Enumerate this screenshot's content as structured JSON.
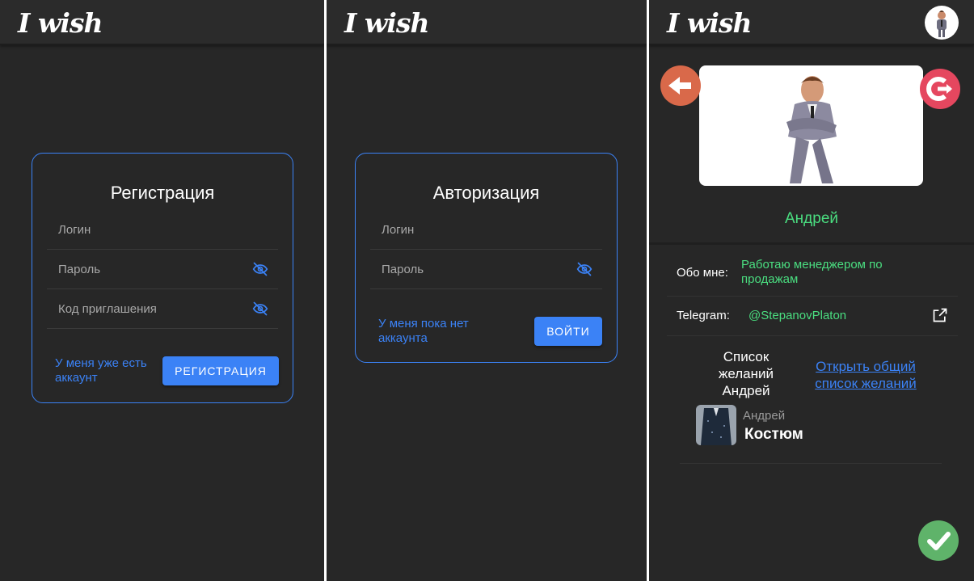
{
  "app": {
    "logo": "I wish"
  },
  "register": {
    "title": "Регистрация",
    "login_label": "Логин",
    "password_label": "Пароль",
    "invite_label": "Код приглашения",
    "have_account_link": "У меня уже есть аккаунт",
    "submit_label": "РЕГИСТРАЦИЯ"
  },
  "auth": {
    "title": "Авторизация",
    "login_label": "Логин",
    "password_label": "Пароль",
    "no_account_link": "У меня пока нет аккаунта",
    "submit_label": "ВОЙТИ"
  },
  "profile": {
    "name": "Андрей",
    "about_label": "Обо мне:",
    "about_value": "Работаю менеджером по продажам",
    "telegram_label": "Telegram:",
    "telegram_value": "@StepanovPlaton",
    "wishlist_title": "Список желаний Андрей",
    "open_common_link": "Открыть общий список желаний",
    "wish_item": {
      "author": "Андрей",
      "name": "Костюм"
    }
  },
  "colors": {
    "background": "#272727",
    "accent": "#3b82f6",
    "green_text": "#4ade80",
    "back_button": "#d9694a",
    "logout_button": "#e5475f",
    "confirm_button": "#5fb36a"
  },
  "icons": [
    "eye-off-icon",
    "arrow-left-icon",
    "logout-icon",
    "external-link-icon",
    "check-icon"
  ]
}
